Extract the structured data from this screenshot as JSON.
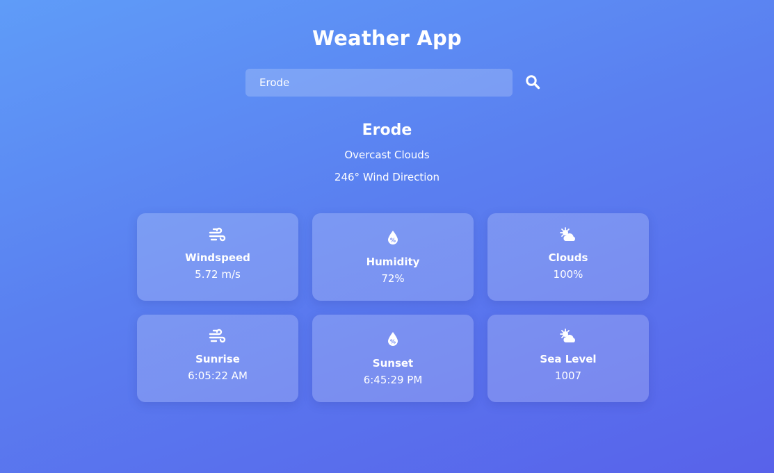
{
  "app": {
    "title": "Weather App"
  },
  "search": {
    "value": "Erode",
    "icon": "search-icon"
  },
  "weather": {
    "city": "Erode",
    "description": "Overcast Clouds",
    "wind_direction": "246° Wind Direction"
  },
  "cards": [
    {
      "icon": "wind-icon",
      "label": "Windspeed",
      "value": "5.72 m/s"
    },
    {
      "icon": "humidity-drop-icon",
      "label": "Humidity",
      "value": "72%"
    },
    {
      "icon": "cloud-sun-icon",
      "label": "Clouds",
      "value": "100%"
    },
    {
      "icon": "wind-icon",
      "label": "Sunrise",
      "value": "6:05:22 AM"
    },
    {
      "icon": "humidity-drop-icon",
      "label": "Sunset",
      "value": "6:45:29 PM"
    },
    {
      "icon": "cloud-sun-icon",
      "label": "Sea Level",
      "value": "1007"
    }
  ],
  "colors": {
    "background_start": "#5f9cf8",
    "background_end": "#5862ea",
    "text": "#ffffff"
  }
}
